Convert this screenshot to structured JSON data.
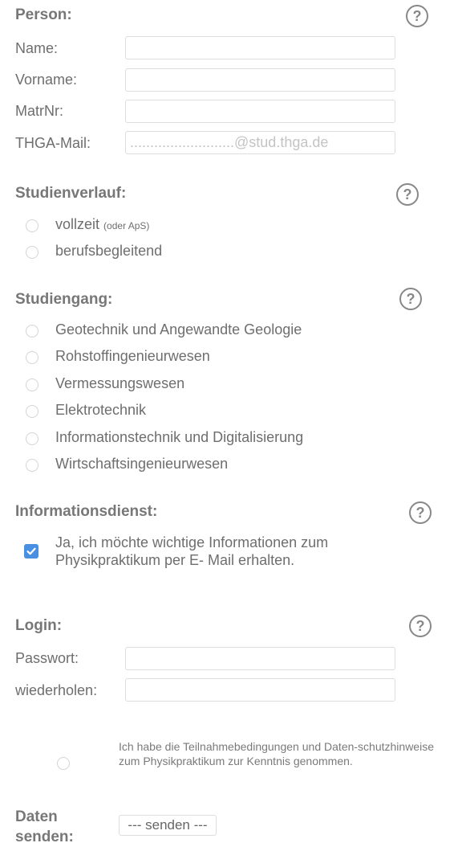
{
  "person": {
    "heading": "Person:",
    "help": "?",
    "fields": [
      {
        "label": "Name:",
        "value": "",
        "placeholder": ""
      },
      {
        "label": "Vorname:",
        "value": "",
        "placeholder": ""
      },
      {
        "label": "MatrNr:",
        "value": "",
        "placeholder": ""
      },
      {
        "label": "THGA-Mail:",
        "value": "",
        "placeholder": "..........................@stud.thga.de"
      }
    ]
  },
  "studienverlauf": {
    "heading": "Studienverlauf:",
    "help": "?",
    "options": [
      {
        "label": "vollzeit",
        "note": "(oder ApS)",
        "checked": false
      },
      {
        "label": "berufsbegleitend",
        "note": "",
        "checked": false
      }
    ]
  },
  "studiengang": {
    "heading": "Studiengang:",
    "help": "?",
    "options": [
      {
        "label": "Geotechnik und Angewandte Geologie",
        "checked": false
      },
      {
        "label": "Rohstoffingenieurwesen",
        "checked": false
      },
      {
        "label": "Vermessungswesen",
        "checked": false
      },
      {
        "label": "Elektrotechnik",
        "checked": false
      },
      {
        "label": "Informationstechnik und Digitalisierung",
        "checked": false
      },
      {
        "label": "Wirtschaftsingenieurwesen",
        "checked": false
      }
    ]
  },
  "informationsdienst": {
    "heading": "Informationsdienst:",
    "help": "?",
    "checkbox_checked": true,
    "text": "Ja, ich möchte wichtige Informationen zum Physikpraktikum per E- Mail erhalten."
  },
  "login": {
    "heading": "Login:",
    "help": "?",
    "fields": [
      {
        "label": "Passwort:",
        "value": ""
      },
      {
        "label": "wiederholen:",
        "value": ""
      }
    ]
  },
  "terms": {
    "checked": false,
    "text": "Ich habe die Teilnahmebedingungen und Daten-schutzhinweise zum Physikpraktikum zur Kenntnis genommen."
  },
  "submit": {
    "label_line1": "Daten",
    "label_line2": "senden:",
    "button": "--- senden ---"
  },
  "colors": {
    "accent": "#4a90e2",
    "text": "#6e6e6e",
    "heading": "#777777",
    "border": "#dddddd"
  }
}
